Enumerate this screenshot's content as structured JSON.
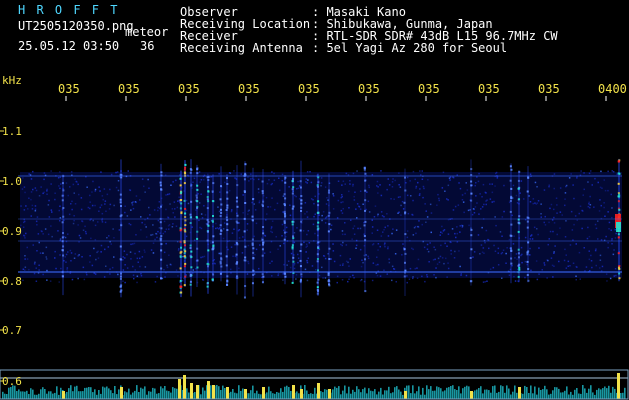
{
  "header": {
    "app_title": "H R O F F T",
    "filename": "UT2505120350.png",
    "tag": "meteor",
    "date_time": "25.05.12 03:50",
    "count": "36",
    "fields": [
      {
        "label": "Observer",
        "value": "Masaki Kano"
      },
      {
        "label": "Receiving Location",
        "value": "Shibukawa, Gunma, Japan"
      },
      {
        "label": "Receiver",
        "value": "RTL-SDR SDR# 43dB L15 96.7MHz CW"
      },
      {
        "label": "Receiving Antenna",
        "value": "5el Yagi Az 280 for Seoul"
      }
    ]
  },
  "axis": {
    "unit": "kHz",
    "y_ticks": [
      "1.1",
      "1.0",
      "0.9",
      "0.8",
      "0.7",
      "0.6"
    ],
    "time_ticks": [
      "035",
      "035",
      "035",
      "035",
      "035",
      "035",
      "035",
      "035",
      "035",
      "0400"
    ]
  },
  "colors": {
    "header_text": "#4fd7ff",
    "info_text": "#ffffff",
    "axis_labels": "#f2e24a",
    "band": "#1a2fd0",
    "signal_hot": "#ff2020",
    "signal_mid": "#22e6d2",
    "bottom_bars": "#f2e24a"
  }
}
